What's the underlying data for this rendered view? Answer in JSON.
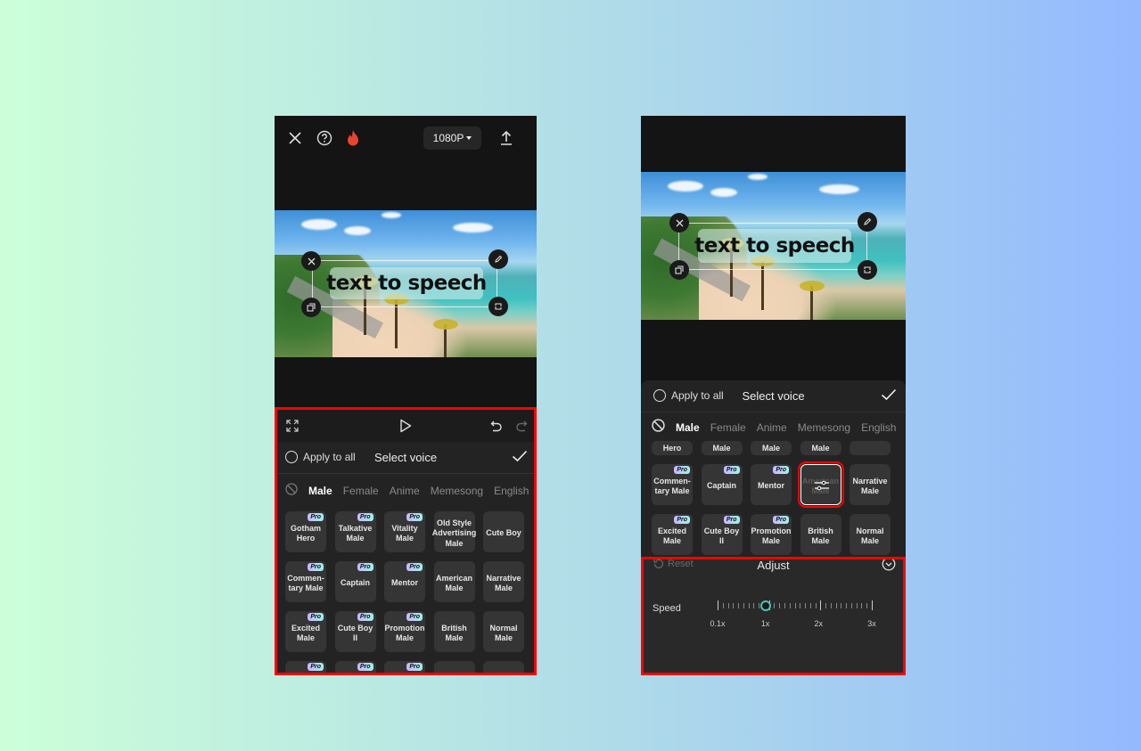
{
  "left_screen": {
    "topbar": {
      "close_icon": "close-icon",
      "help_icon": "help-icon",
      "hot_icon": "flame-icon",
      "resolution": "1080P",
      "export_icon": "upload-icon"
    },
    "video": {
      "overlay_text": "text to speech"
    },
    "controls": {
      "fullscreen_icon": "fullscreen-icon",
      "play_icon": "play-icon",
      "undo_icon": "undo-icon",
      "redo_icon": "redo-icon"
    },
    "voice_sheet": {
      "apply_all_label": "Apply to all",
      "title": "Select voice",
      "categories": [
        "Male",
        "Female",
        "Anime",
        "Memesong",
        "English"
      ],
      "active_category": "Male",
      "pro_label": "Pro",
      "voices": [
        {
          "name": "Gotham Hero",
          "pro": true
        },
        {
          "name": "Talkative Male",
          "pro": true
        },
        {
          "name": "Vitality Male",
          "pro": true
        },
        {
          "name": "Old Style Advertising Male",
          "pro": false
        },
        {
          "name": "Cute Boy",
          "pro": false
        },
        {
          "name": "Commen-tary Male",
          "pro": true
        },
        {
          "name": "Captain",
          "pro": true
        },
        {
          "name": "Mentor",
          "pro": true
        },
        {
          "name": "American Male",
          "pro": false
        },
        {
          "name": "Narrative Male",
          "pro": false
        },
        {
          "name": "Excited Male",
          "pro": true
        },
        {
          "name": "Cute Boy II",
          "pro": true
        },
        {
          "name": "Promotion Male",
          "pro": true
        },
        {
          "name": "British Male",
          "pro": false
        },
        {
          "name": "Normal Male",
          "pro": false
        },
        {
          "name": "",
          "pro": true
        },
        {
          "name": "",
          "pro": true
        },
        {
          "name": "",
          "pro": true
        },
        {
          "name": "",
          "pro": false
        },
        {
          "name": "",
          "pro": false
        }
      ]
    }
  },
  "right_screen": {
    "video": {
      "overlay_text": "text to speech"
    },
    "voice_sheet": {
      "apply_all_label": "Apply to all",
      "title": "Select voice",
      "categories": [
        "Male",
        "Female",
        "Anime",
        "Memesong",
        "English"
      ],
      "active_category": "Male",
      "pro_label": "Pro",
      "partial_row": [
        "Hero",
        "Male",
        "Male",
        "Male",
        ""
      ],
      "voices": [
        {
          "name": "Commen-tary Male",
          "pro": true
        },
        {
          "name": "Captain",
          "pro": true
        },
        {
          "name": "Mentor",
          "pro": true
        },
        {
          "name": "American Male",
          "pro": false,
          "selected": true
        },
        {
          "name": "Narrative Male",
          "pro": false
        },
        {
          "name": "Excited Male",
          "pro": true
        },
        {
          "name": "Cute Boy II",
          "pro": true
        },
        {
          "name": "Promotion Male",
          "pro": true
        },
        {
          "name": "British Male",
          "pro": false
        },
        {
          "name": "Normal Male",
          "pro": false
        }
      ]
    },
    "adjust": {
      "reset_label": "Reset",
      "title": "Adjust",
      "speed_label": "Speed",
      "speed_value": "1x",
      "speed_value_fraction": 0.31,
      "scale_labels": [
        "0.1x",
        "1x",
        "2x",
        "3x"
      ]
    }
  },
  "colors": {
    "highlight": "#ff0000",
    "slider_accent": "#46c6b1",
    "panel_bg": "#232323"
  }
}
